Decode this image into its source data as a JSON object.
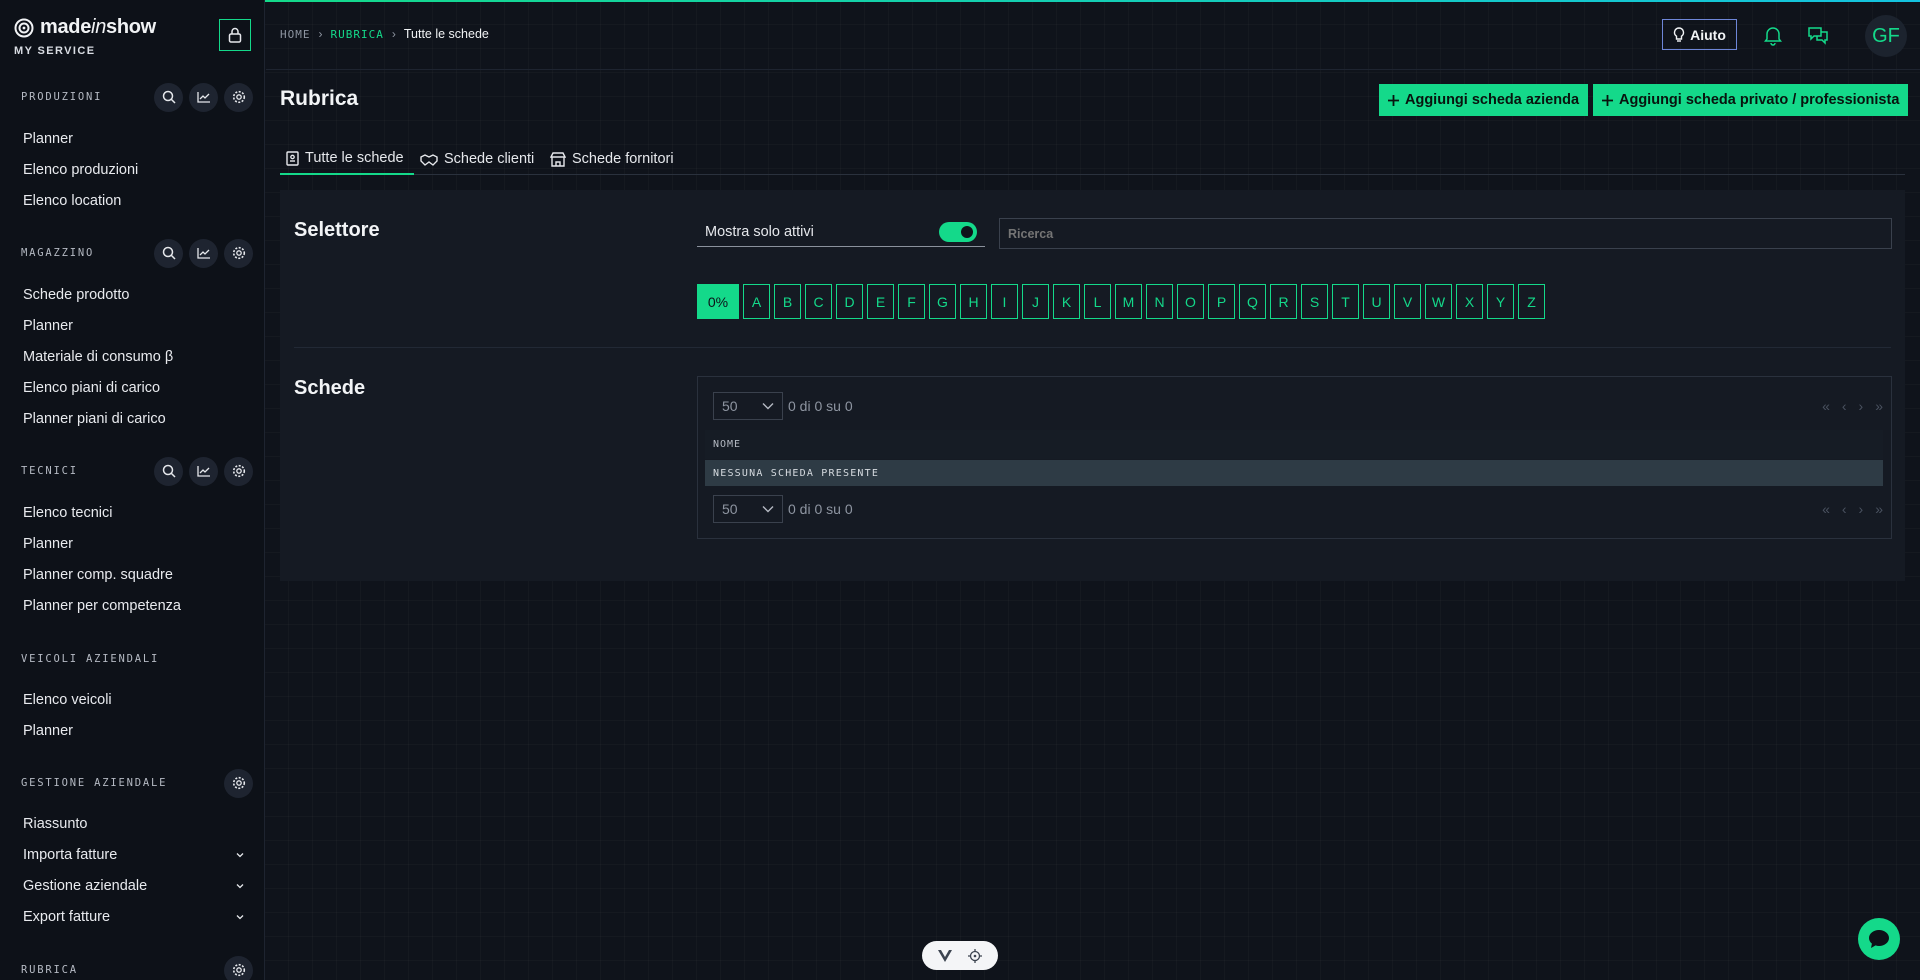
{
  "brand": {
    "name_bold": "made",
    "name_italic": "in",
    "name_end": "show",
    "subtitle": "MY SERVICE"
  },
  "sidebar": {
    "sections": [
      {
        "title": "PRODUZIONI",
        "items": [
          "Planner",
          "Elenco produzioni",
          "Elenco location"
        ]
      },
      {
        "title": "MAGAZZINO",
        "items": [
          "Schede prodotto",
          "Planner",
          "Materiale di consumo β",
          "Elenco piani di carico",
          "Planner piani di carico"
        ]
      },
      {
        "title": "TECNICI",
        "items": [
          "Elenco tecnici",
          "Planner",
          "Planner comp. squadre",
          "Planner per competenza"
        ]
      },
      {
        "title": "VEICOLI AZIENDALI",
        "items": [
          "Elenco veicoli",
          "Planner"
        ]
      },
      {
        "title": "GESTIONE AZIENDALE",
        "items": [
          "Riassunto",
          "Importa fatture",
          "Gestione aziendale",
          "Export fatture"
        ]
      },
      {
        "title": "RUBRICA"
      }
    ]
  },
  "breadcrumb": {
    "home": "HOME",
    "section": "RUBRICA",
    "current": "Tutte le schede"
  },
  "header": {
    "help": "Aiuto",
    "avatar": "GF"
  },
  "page": {
    "title": "Rubrica",
    "add_company": "Aggiungi scheda azienda",
    "add_private": "Aggiungi scheda privato / professionista"
  },
  "tabs": [
    "Tutte le schede",
    "Schede clienti",
    "Schede fornitori"
  ],
  "selector": {
    "title": "Selettore",
    "toggle_label": "Mostra solo attivi",
    "toggle_on": true,
    "search_placeholder": "Ricerca",
    "letters": [
      "0%",
      "A",
      "B",
      "C",
      "D",
      "E",
      "F",
      "G",
      "H",
      "I",
      "J",
      "K",
      "L",
      "M",
      "N",
      "O",
      "P",
      "Q",
      "R",
      "S",
      "T",
      "U",
      "V",
      "W",
      "X",
      "Y",
      "Z"
    ]
  },
  "schede": {
    "title": "Schede",
    "page_size": "50",
    "count": "0 di 0 su 0",
    "column": "NOME",
    "empty": "NESSUNA SCHEDA PRESENTE"
  },
  "colors": {
    "accent": "#14d98a",
    "background": "#0f131b",
    "panel": "#151a23"
  }
}
